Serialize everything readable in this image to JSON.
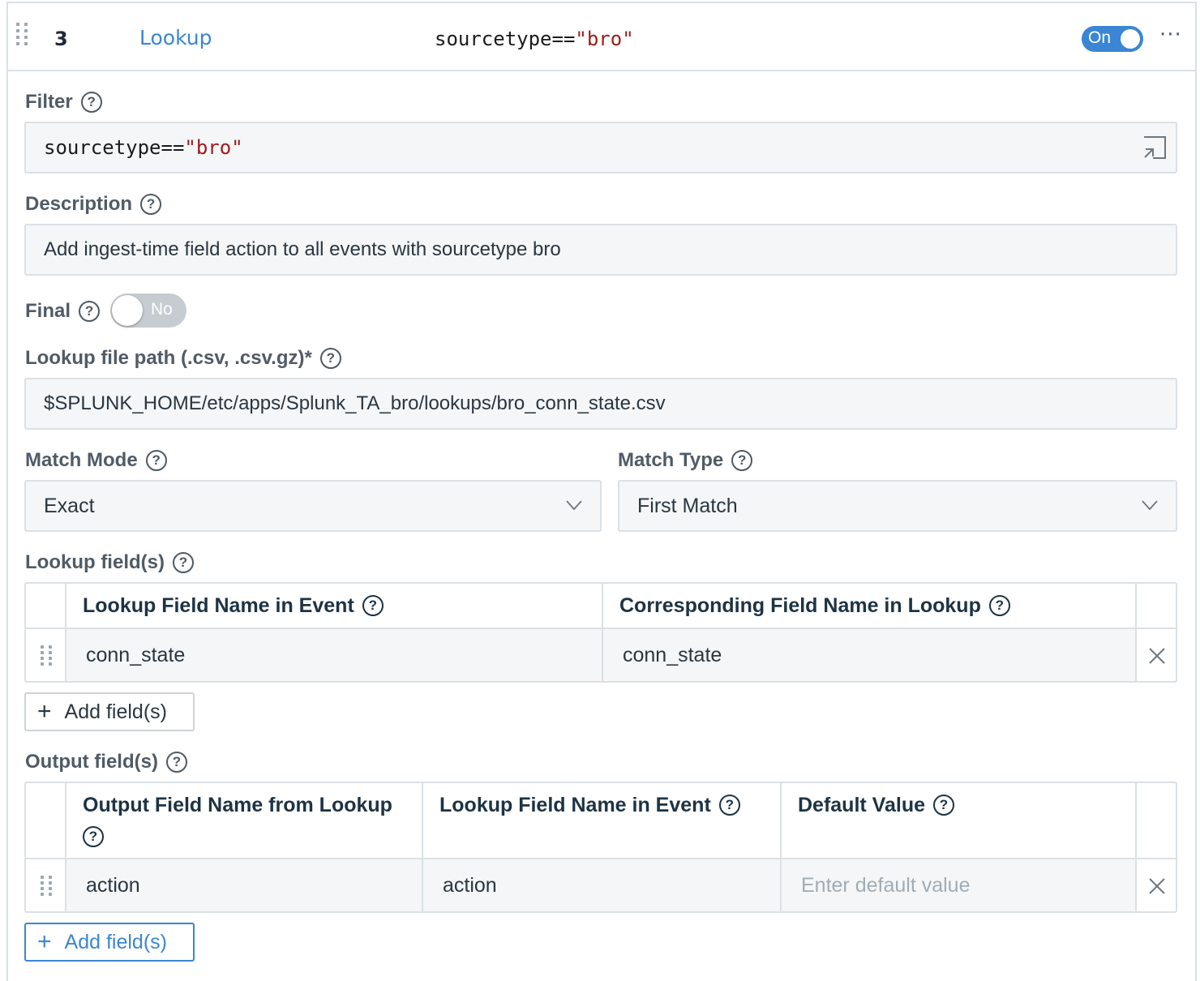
{
  "header": {
    "rule_number": "3",
    "function_name": "Lookup",
    "filter_key": "sourcetype==",
    "filter_value": "\"bro\"",
    "toggle_label": "On",
    "more_icon": "more-horizontal-icon"
  },
  "filter": {
    "label": "Filter",
    "value_key": "sourcetype==",
    "value_string": "\"bro\""
  },
  "description": {
    "label": "Description",
    "value": "Add ingest-time field action to all events with sourcetype bro"
  },
  "final": {
    "label": "Final",
    "toggle_label": "No"
  },
  "lookup_path": {
    "label": "Lookup file path (.csv, .csv.gz)*",
    "value": "$SPLUNK_HOME/etc/apps/Splunk_TA_bro/lookups/bro_conn_state.csv"
  },
  "match_mode": {
    "label": "Match Mode",
    "value": "Exact"
  },
  "match_type": {
    "label": "Match Type",
    "value": "First Match"
  },
  "lookup_fields": {
    "label": "Lookup field(s)",
    "headers": [
      "Lookup Field Name in Event",
      "Corresponding Field Name in Lookup"
    ],
    "rows": [
      [
        "conn_state",
        "conn_state"
      ]
    ],
    "add_button": "Add field(s)"
  },
  "output_fields": {
    "label": "Output field(s)",
    "headers": [
      "Output Field Name from Lookup",
      "Lookup Field Name in Event",
      "Default Value"
    ],
    "rows": [
      [
        "action",
        "action",
        ""
      ]
    ],
    "default_placeholder": "Enter default value",
    "add_button": "Add field(s)"
  },
  "colors": {
    "accent": "#3a86d4",
    "string_literal": "#9b1c1c",
    "input_bg": "#f4f6f8",
    "border": "#dbe1e5"
  }
}
